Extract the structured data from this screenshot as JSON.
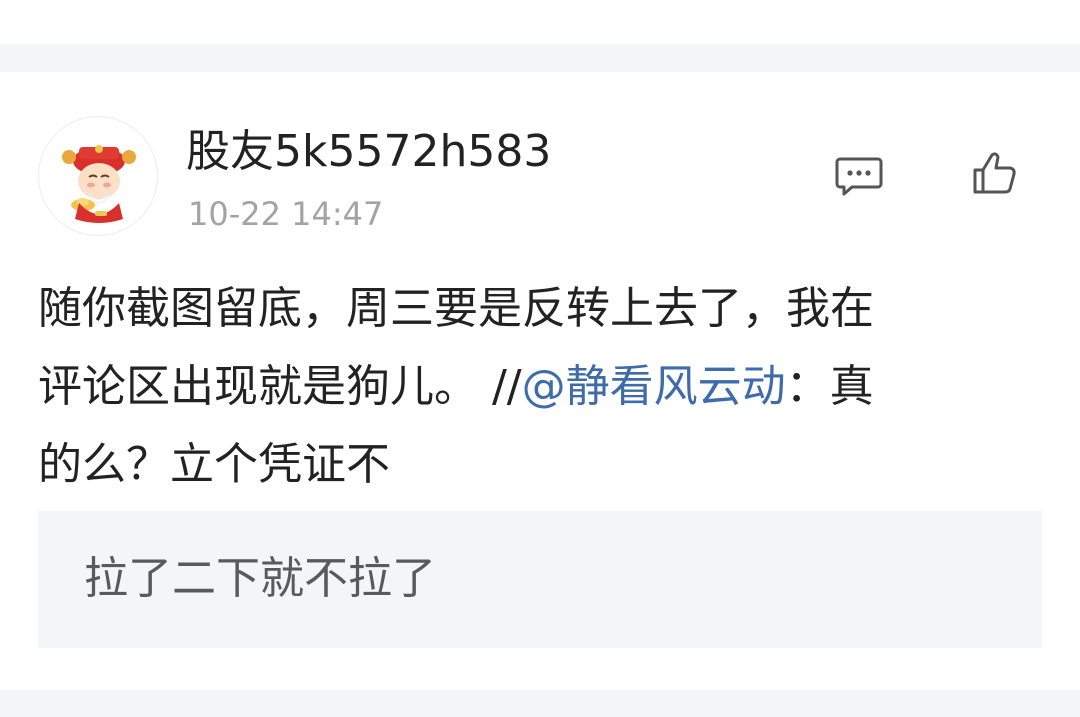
{
  "post": {
    "username": "股友5k5572h583",
    "timestamp": "10-22 14:47",
    "avatar_icon": "caishen-avatar-icon",
    "comment_icon": "comment-icon",
    "like_icon": "thumbs-up-icon",
    "body_line1": "随你截图留底，周三要是反转上去了，我在",
    "body_line2_prefix": "评论区出现就是狗儿。 //",
    "mention": "@静看风云动",
    "body_line2_suffix": "：真",
    "body_line3": "的么？立个凭证不",
    "quoted_reply": "拉了二下就不拉了",
    "colors": {
      "mention": "#3d6bab",
      "text": "#222222",
      "muted": "#a3a3a3",
      "quote_bg": "#f4f5f7"
    }
  }
}
